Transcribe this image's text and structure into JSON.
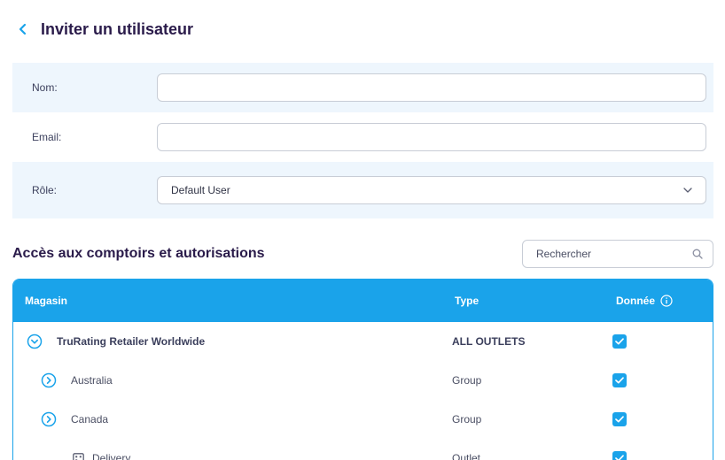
{
  "header": {
    "title": "Inviter un utilisateur"
  },
  "form": {
    "name_label": "Nom:",
    "name_value": "",
    "email_label": "Email:",
    "email_value": "",
    "role_label": "Rôle:",
    "role_value": "Default User"
  },
  "access": {
    "title": "Accès aux comptoirs et autorisations",
    "search_placeholder": "Rechercher"
  },
  "table": {
    "headers": {
      "store": "Magasin",
      "type": "Type",
      "data": "Donnée"
    },
    "rows": [
      {
        "name": "TruRating Retailer Worldwide",
        "type": "ALL OUTLETS",
        "checked": true,
        "icon": "collapse-icon"
      },
      {
        "name": "Australia",
        "type": "Group",
        "checked": true,
        "icon": "expand-icon"
      },
      {
        "name": "Canada",
        "type": "Group",
        "checked": true,
        "icon": "expand-icon"
      },
      {
        "name": "Delivery",
        "type": "Outlet",
        "checked": true,
        "icon": "store-icon"
      }
    ]
  },
  "colors": {
    "accent": "#1aa3ea",
    "title": "#2a1b4a",
    "shaded_row": "#eef6fd"
  }
}
